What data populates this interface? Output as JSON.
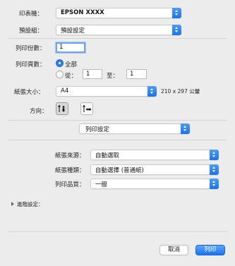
{
  "printer": {
    "label": "印表機：",
    "value": "EPSON XXXX"
  },
  "preset": {
    "label": "預設組：",
    "value": "預設設定"
  },
  "copies": {
    "label": "列印份數：",
    "value": "1"
  },
  "pages": {
    "label": "列印頁數：",
    "all_label": "全部",
    "from_label": "從：",
    "from_value": "1",
    "to_label": "至：",
    "to_value": "1"
  },
  "paper_size": {
    "label": "紙張大小：",
    "value": "A4",
    "dimensions": "210 x 297 公釐"
  },
  "orientation": {
    "label": "方向：",
    "portrait_icon": "portrait-person-icon",
    "landscape_icon": "landscape-person-icon",
    "selected": "portrait"
  },
  "section": {
    "value": "列印設定"
  },
  "paper_source": {
    "label": "紙張來源：",
    "value": "自動選取"
  },
  "media_type": {
    "label": "紙張種類：",
    "value": "自動選擇 (普通紙)"
  },
  "print_quality": {
    "label": "列印品質：",
    "value": "一般"
  },
  "advanced": {
    "label": "進階設定："
  },
  "buttons": {
    "cancel": "取消",
    "print": "列印"
  },
  "colors": {
    "accent": "#1a73f0",
    "background": "#ececec"
  }
}
